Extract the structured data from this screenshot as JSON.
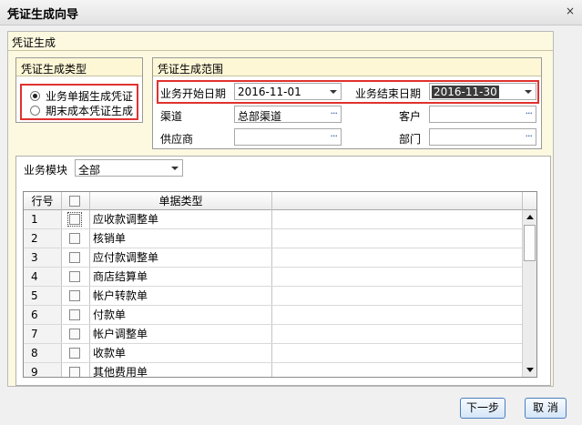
{
  "window": {
    "title": "凭证生成向导",
    "close_glyph": "×"
  },
  "outer_group": {
    "title": "凭证生成"
  },
  "type_group": {
    "title": "凭证生成类型",
    "options": [
      {
        "label": "业务单据生成凭证",
        "selected": true
      },
      {
        "label": "期末成本凭证生成",
        "selected": false
      }
    ]
  },
  "range_group": {
    "title": "凭证生成范围",
    "start_date_label": "业务开始日期",
    "start_date_value": "2016-11-01",
    "end_date_label": "业务结束日期",
    "end_date_value": "2016-11-30",
    "channel_label": "渠道",
    "channel_value": "总部渠道",
    "customer_label": "客户",
    "customer_value": "",
    "supplier_label": "供应商",
    "supplier_value": "",
    "department_label": "部门",
    "department_value": "",
    "ellipsis": "···"
  },
  "module_filter": {
    "label": "业务模块",
    "value": "全部"
  },
  "table": {
    "columns": [
      "行号",
      "",
      "单据类型"
    ],
    "rows": [
      {
        "no": "1",
        "name": "应收款调整单"
      },
      {
        "no": "2",
        "name": "核销单"
      },
      {
        "no": "3",
        "name": "应付款调整单"
      },
      {
        "no": "4",
        "name": "商店结算单"
      },
      {
        "no": "5",
        "name": "帐户转款单"
      },
      {
        "no": "6",
        "name": "付款单"
      },
      {
        "no": "7",
        "name": "帐户调整单"
      },
      {
        "no": "8",
        "name": "收款单"
      },
      {
        "no": "9",
        "name": "其他费用单"
      }
    ]
  },
  "buttons": {
    "next": "下一步",
    "cancel": "取 消"
  },
  "colors": {
    "highlight": "#e0322f",
    "panel_bg": "#fdf9e0",
    "button_border": "#4a7dbf"
  }
}
